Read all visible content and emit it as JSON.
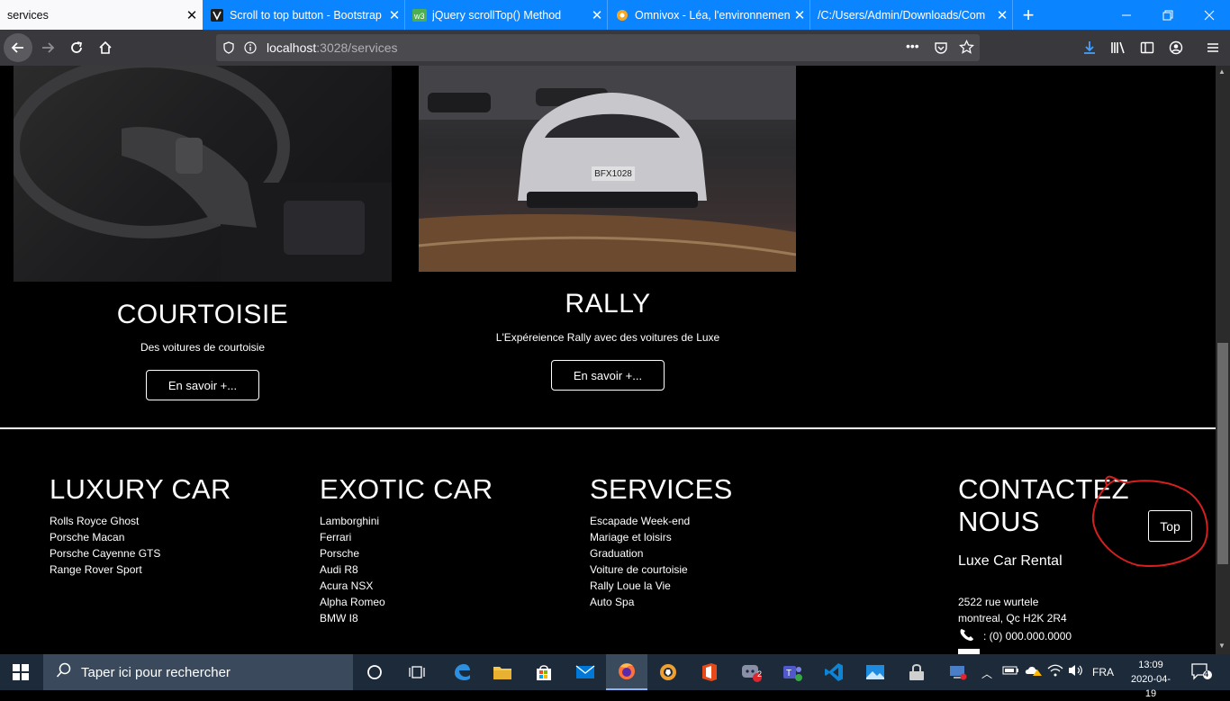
{
  "browser": {
    "tabs": [
      {
        "title": "services",
        "active": true
      },
      {
        "title": "Scroll to top button - Bootstrap",
        "active": false
      },
      {
        "title": "jQuery scrollTop() Method",
        "active": false
      },
      {
        "title": "Omnivox - Léa, l'environnement",
        "active": false
      },
      {
        "title": "/C:/Users/Admin/Downloads/Com",
        "active": false
      }
    ],
    "url_host": "localhost",
    "url_rest": ":3028/services",
    "more": "•••"
  },
  "services": [
    {
      "title": "COURTOISIE",
      "subtitle": "Des voitures de courtoisie",
      "button": "En savoir +..."
    },
    {
      "title": "RALLY",
      "subtitle": "L'Expéreience Rally avec des voitures de Luxe",
      "button": "En savoir +..."
    }
  ],
  "footer": {
    "luxury": {
      "heading": "LUXURY CAR",
      "items": [
        "Rolls Royce Ghost",
        "Porsche Macan",
        "Porsche Cayenne GTS",
        "Range Rover Sport"
      ]
    },
    "exotic": {
      "heading": "EXOTIC CAR",
      "items": [
        "Lamborghini",
        "Ferrari",
        "Porsche",
        "Audi R8",
        "Acura NSX",
        "Alpha Romeo",
        "BMW I8"
      ]
    },
    "services": {
      "heading": "SERVICES",
      "items": [
        "Escapade Week-end",
        "Mariage et loisirs",
        "Graduation",
        "Voiture de courtoisie",
        "Rally Loue la Vie",
        "Auto Spa"
      ]
    },
    "contact": {
      "heading_line1": "CONTACTEZ",
      "heading_line2": "NOUS",
      "company": "Luxe Car Rental",
      "address1": "2522 rue wurtele",
      "address2": "montreal, Qc H2K 2R4",
      "phone": ": (0) 000.000.0000"
    }
  },
  "top_button": "Top",
  "rally_plate": "BFX1028",
  "taskbar": {
    "search_placeholder": "Taper ici pour rechercher",
    "language": "FRA",
    "time": "13:09",
    "date": "2020-04-19",
    "notifications": "4",
    "badge_count": "2"
  }
}
